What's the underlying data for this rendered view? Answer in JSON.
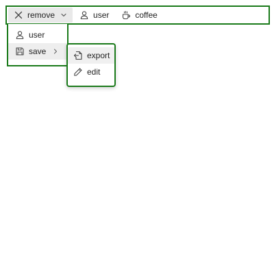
{
  "menubar": {
    "items": [
      {
        "label": "remove",
        "icon": "close-icon"
      },
      {
        "label": "user",
        "icon": "user-icon"
      },
      {
        "label": "coffee",
        "icon": "coffee-icon"
      }
    ]
  },
  "dropdown": {
    "items": [
      {
        "label": "user",
        "icon": "user-icon"
      },
      {
        "label": "save",
        "icon": "save-icon"
      }
    ]
  },
  "submenu": {
    "items": [
      {
        "label": "export",
        "icon": "export-icon"
      },
      {
        "label": "edit",
        "icon": "pencil-icon"
      }
    ]
  },
  "colors": {
    "border_accent": "#1a7a1a",
    "active_background": "#e9e9e9"
  }
}
